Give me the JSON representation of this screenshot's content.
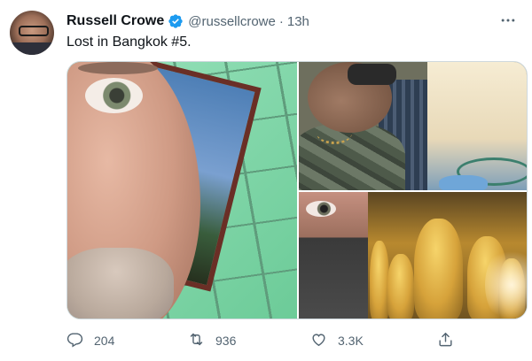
{
  "tweet": {
    "author_name": "Russell Crowe",
    "handle": "@russellcrowe",
    "separator": "·",
    "time": "13h",
    "text": "Lost in Bangkok #5."
  },
  "icons": {
    "verified": "verified-badge-icon",
    "more": "more-icon",
    "reply": "reply-icon",
    "retweet": "retweet-icon",
    "like": "like-icon",
    "share": "share-icon"
  },
  "actions": {
    "reply_count": "204",
    "retweet_count": "936",
    "like_count": "3.3K"
  },
  "colors": {
    "verified": "#1d9bf0",
    "muted_text": "#536471"
  }
}
